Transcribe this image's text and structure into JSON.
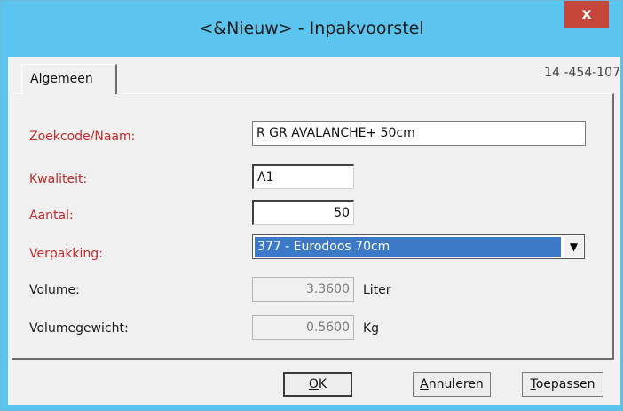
{
  "window": {
    "title": "<&Nieuw> - Inpakvoorstel",
    "close_glyph": "x"
  },
  "tabs": [
    {
      "label": "Algemeen"
    }
  ],
  "header_code": "14 -454-107",
  "form": {
    "zoekcode": {
      "label": "Zoekcode/Naam:",
      "value": "R GR AVALANCHE+ 50cm"
    },
    "kwaliteit": {
      "label": "Kwaliteit:",
      "value": "A1"
    },
    "aantal": {
      "label": "Aantal:",
      "value": "50"
    },
    "verpakking": {
      "label": "Verpakking:",
      "value": "377 - Eurodoos 70cm",
      "arrow": "▼"
    },
    "volume": {
      "label": "Volume:",
      "value": "3.3600",
      "unit": "Liter"
    },
    "volumegewicht": {
      "label": "Volumegewicht:",
      "value": "0.5600",
      "unit": "Kg"
    }
  },
  "buttons": {
    "ok": {
      "mnemonic": "O",
      "rest": "K"
    },
    "annuleren": {
      "mnemonic": "A",
      "rest": "nnuleren"
    },
    "toepassen": {
      "mnemonic": "T",
      "rest": "oepassen"
    }
  },
  "colors": {
    "titlebar": "#5bc5ef",
    "close": "#c7463c",
    "required_label": "#c42a2a",
    "selection": "#3c79c6"
  }
}
